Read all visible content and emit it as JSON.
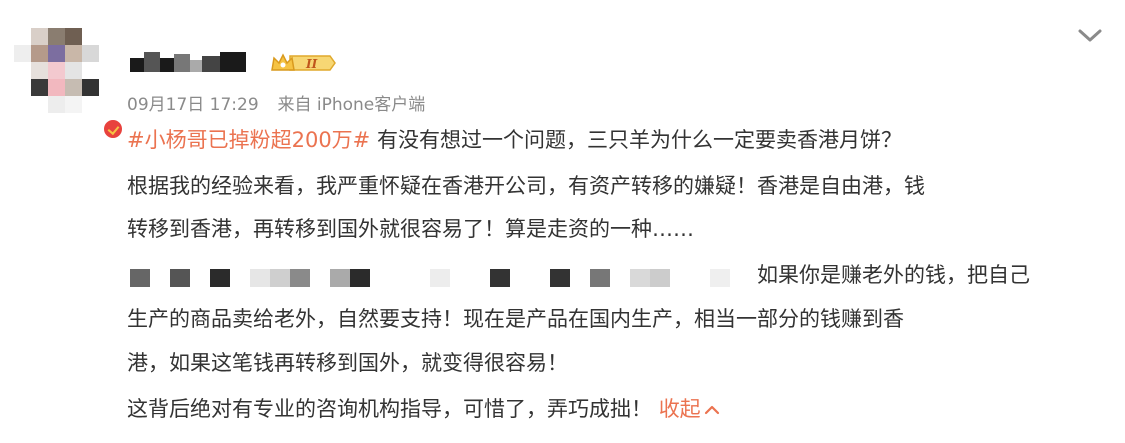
{
  "header": {
    "timestamp": "09月17日 17:29",
    "source": "来自 iPhone客户端",
    "badge_level": "II"
  },
  "post": {
    "topic": "#小杨哥已掉粉超200万#",
    "line1_text": " 有没有想过一个问题，三只羊为什么一定要卖香港月饼？",
    "line2": "根据我的经验来看，我严重怀疑在香港开公司，有资产转移的嫌疑！香港是自由港，钱",
    "line3": "转移到香港，再转移到国外就很容易了！算是走资的一种……",
    "line4_text": "如果你是赚老外的钱，把自己",
    "line5": "生产的商品卖给老外，自然要支持！现在是产品在国内生产，相当一部分的钱赚到香",
    "line6": "港，如果这笔钱再转移到国外，就变得很容易！",
    "line7_text": "这背后绝对有专业的咨询机构指导，可惜了，弄巧成拙！",
    "collapse_label": "收起"
  },
  "icons": [
    "avatar",
    "verified-badge",
    "crown-level-badge",
    "chevron-down-icon",
    "chevron-up-icon"
  ],
  "colors": {
    "accent": "#eb7350",
    "text": "#333333",
    "meta": "#8a8a8a"
  }
}
